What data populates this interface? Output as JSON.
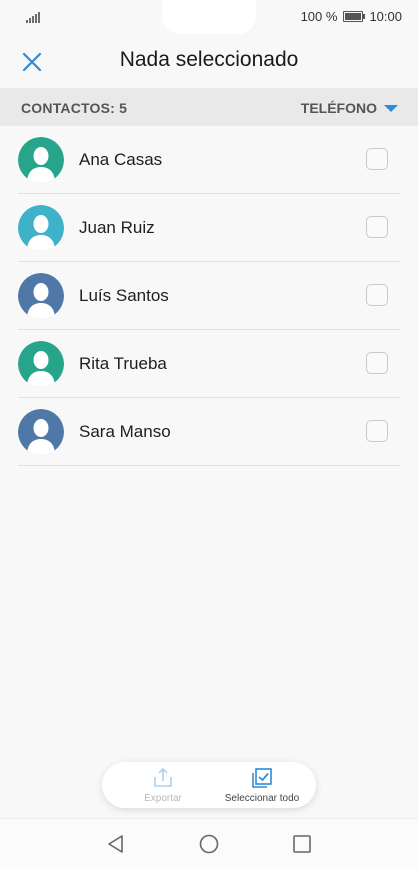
{
  "status_bar": {
    "battery_text": "100 %",
    "time": "10:00"
  },
  "title_bar": {
    "close_icon": "close-icon",
    "title": "Nada seleccionado"
  },
  "list_header": {
    "count_label": "CONTACTOS: 5",
    "filter_label": "TELÉFONO",
    "accent_color": "#2f8bd8"
  },
  "contacts": [
    {
      "name": "Ana Casas",
      "avatar_color": "#26a58a",
      "checked": false
    },
    {
      "name": "Juan Ruiz",
      "avatar_color": "#3fb1c9",
      "checked": false
    },
    {
      "name": "Luís Santos",
      "avatar_color": "#4f78a8",
      "checked": false
    },
    {
      "name": "Rita Trueba",
      "avatar_color": "#26a58a",
      "checked": false
    },
    {
      "name": "Sara Manso",
      "avatar_color": "#4f78a8",
      "checked": false
    }
  ],
  "action_bar": {
    "export_label": "Exportar",
    "export_enabled": false,
    "select_all_label": "Seleccionar todo"
  },
  "nav_bar": {
    "buttons": [
      "back-icon",
      "home-icon",
      "recents-icon"
    ]
  }
}
